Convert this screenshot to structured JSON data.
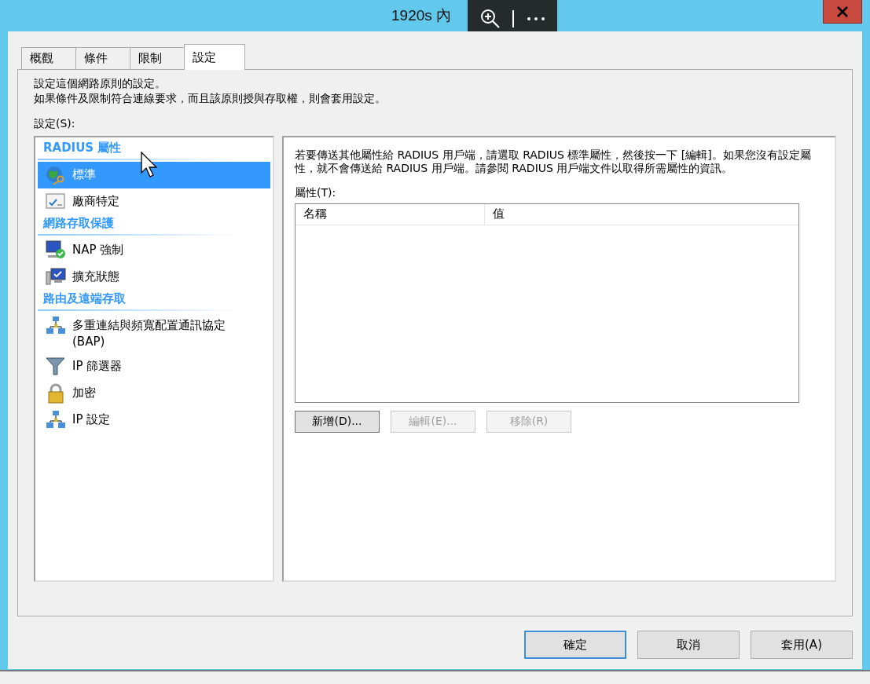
{
  "window": {
    "title": "1920s 內"
  },
  "tabs": [
    {
      "label": "概觀",
      "selected": false
    },
    {
      "label": "條件",
      "selected": false
    },
    {
      "label": "限制",
      "selected": false
    },
    {
      "label": "設定",
      "selected": true
    }
  ],
  "description": [
    "設定這個網路原則的設定。",
    "如果條件及限制符合連線要求，而且該原則授與存取權，則會套用設定。"
  ],
  "settings_label": "設定(S):",
  "sidebar": {
    "groups": [
      {
        "title": "RADIUS 屬性",
        "items": [
          {
            "label": "標準",
            "selected": true
          },
          {
            "label": "廠商特定",
            "selected": false
          }
        ]
      },
      {
        "title": "網路存取保護",
        "items": [
          {
            "label": "NAP 強制",
            "selected": false
          },
          {
            "label": "擴充狀態",
            "selected": false
          }
        ]
      },
      {
        "title": "路由及遠端存取",
        "items": [
          {
            "label": "多重連結與頻寬配置通訊協定 (BAP)",
            "selected": false
          },
          {
            "label": "IP 篩選器",
            "selected": false
          },
          {
            "label": "加密",
            "selected": false
          },
          {
            "label": "IP 設定",
            "selected": false
          }
        ]
      }
    ]
  },
  "detail": {
    "text": "若要傳送其他屬性給 RADIUS 用戶端，請選取 RADIUS 標準屬性，然後按一下 [編輯]。如果您沒有設定屬性，就不會傳送給 RADIUS 用戶端。請參閱 RADIUS 用戶端文件以取得所需屬性的資訊。",
    "attributes_label": "屬性(T):",
    "table": {
      "columns": [
        "名稱",
        "值"
      ]
    },
    "buttons": [
      {
        "label": "新增(D)...",
        "disabled": false
      },
      {
        "label": "編輯(E)...",
        "disabled": true
      },
      {
        "label": "移除(R)",
        "disabled": true
      }
    ]
  },
  "footer_buttons": [
    {
      "label": "確定",
      "default": true
    },
    {
      "label": "取消",
      "default": false
    },
    {
      "label": "套用(A)",
      "default": false
    }
  ]
}
